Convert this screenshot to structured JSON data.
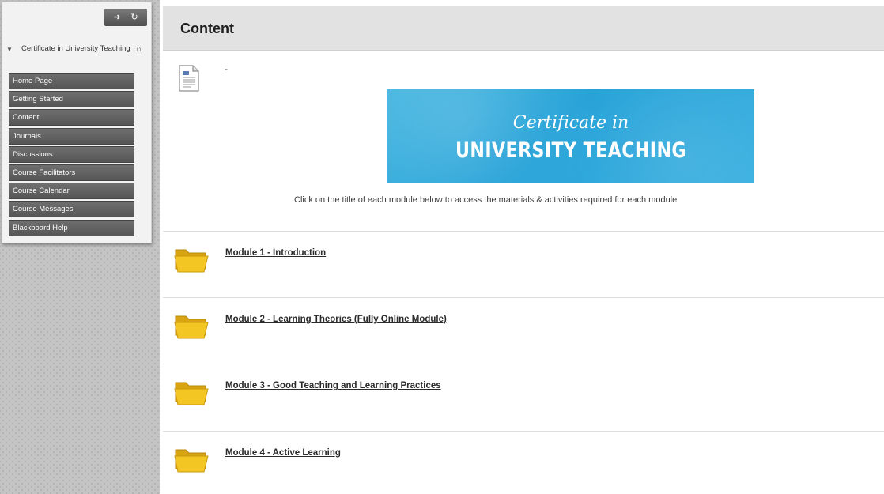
{
  "sidebar": {
    "toolbar": {
      "collapse_icon": "arrow-icon",
      "refresh_icon": "refresh-icon"
    },
    "course_title": "Certificate in University Teaching",
    "home_icon": "home-icon",
    "menu_items": [
      "Home Page",
      "Getting Started",
      "Content",
      "Journals",
      "Discussions",
      "Course Facilitators",
      "Course Calendar",
      "Course Messages",
      "Blackboard Help"
    ]
  },
  "main": {
    "page_title": "Content",
    "item": {
      "icon": "document-icon",
      "title": "-",
      "banner": {
        "script_text": "Certificate in",
        "main_text": "UNIVERSITY TEACHING"
      },
      "instruction": "Click on the title of each module below to access the materials & activities required for each module"
    },
    "modules": [
      {
        "title": "Module 1 - Introduction"
      },
      {
        "title": "Module 2 - Learning Theories (Fully Online Module)"
      },
      {
        "title": "Module 3 - Good Teaching and Learning Practices"
      },
      {
        "title": "Module 4 - Active Learning"
      }
    ]
  },
  "colors": {
    "banner_blue": "#1f9fd6",
    "menu_gray": "#5f5f5f",
    "header_gray": "#e2e2e2",
    "folder_yellow": "#f3c623"
  }
}
